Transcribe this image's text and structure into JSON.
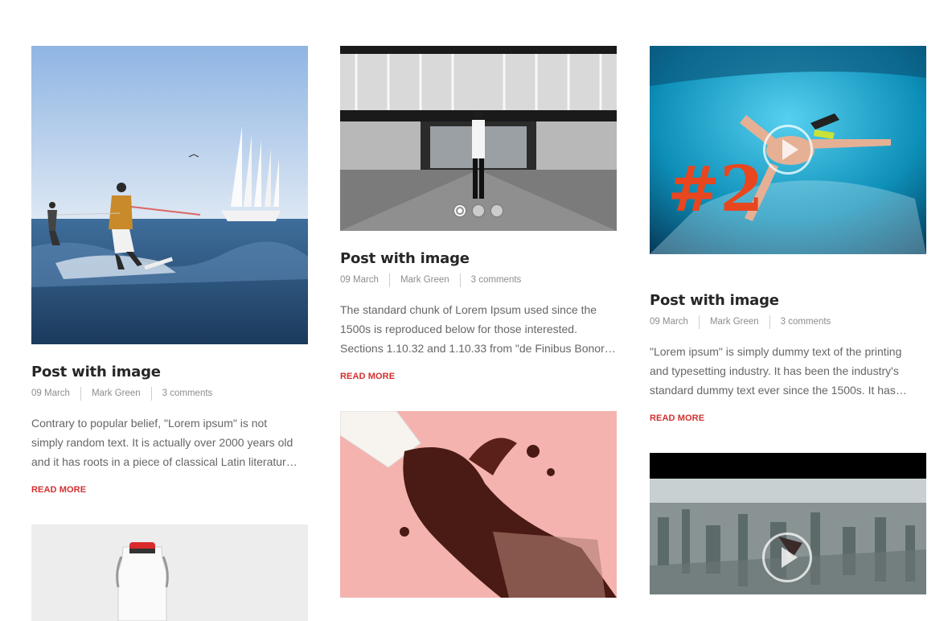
{
  "posts": [
    {
      "title": "Post with image",
      "date": "09 March",
      "author": "Mark Green",
      "comments": "3 comments",
      "excerpt_line1": "Contrary to popular belief, \"Lorem ipsum\" is not",
      "excerpt_line2": "simply random text. It is actually over 2000 years old",
      "excerpt_line3": "and it has roots in a piece of classical Latin literatur…",
      "read_more": "READ MORE"
    },
    {
      "title": "Post with image",
      "date": "09 March",
      "author": "Mark Green",
      "comments": "3 comments",
      "excerpt_line1": "The standard chunk of Lorem Ipsum used since the",
      "excerpt_line2": "1500s is reproduced below for those interested.",
      "excerpt_line3": "Sections 1.10.32 and 1.10.33 from \"de Finibus Bonoru…",
      "read_more": "READ MORE"
    },
    {
      "title": "Post with image",
      "date": "09 March",
      "author": "Mark Green",
      "comments": "3 comments",
      "excerpt_line1": "\"Lorem ipsum\" is simply dummy text of the printing",
      "excerpt_line2": "and typesetting industry. It has been the industry's",
      "excerpt_line3": "standard dummy text ever since the 1500s. It has…",
      "read_more": "READ MORE"
    }
  ],
  "video_overlay_text": "#2",
  "slider_dots": 3,
  "colors": {
    "accent": "#d42f2f",
    "title": "#262626",
    "meta": "#8d8d8d",
    "text": "#666666"
  }
}
